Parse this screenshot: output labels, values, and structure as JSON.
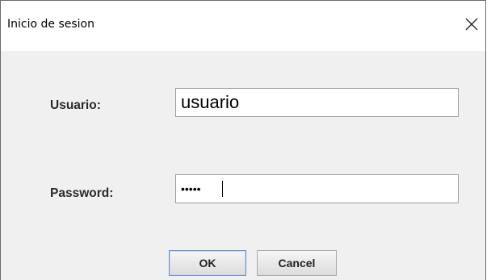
{
  "window": {
    "title": "Inicio de sesion",
    "close_icon": "close-icon"
  },
  "form": {
    "username_label": "Usuario:",
    "username_value": "usuario",
    "password_label": "Password:",
    "password_value": "•••••"
  },
  "buttons": {
    "ok_label": "OK",
    "cancel_label": "Cancel"
  }
}
